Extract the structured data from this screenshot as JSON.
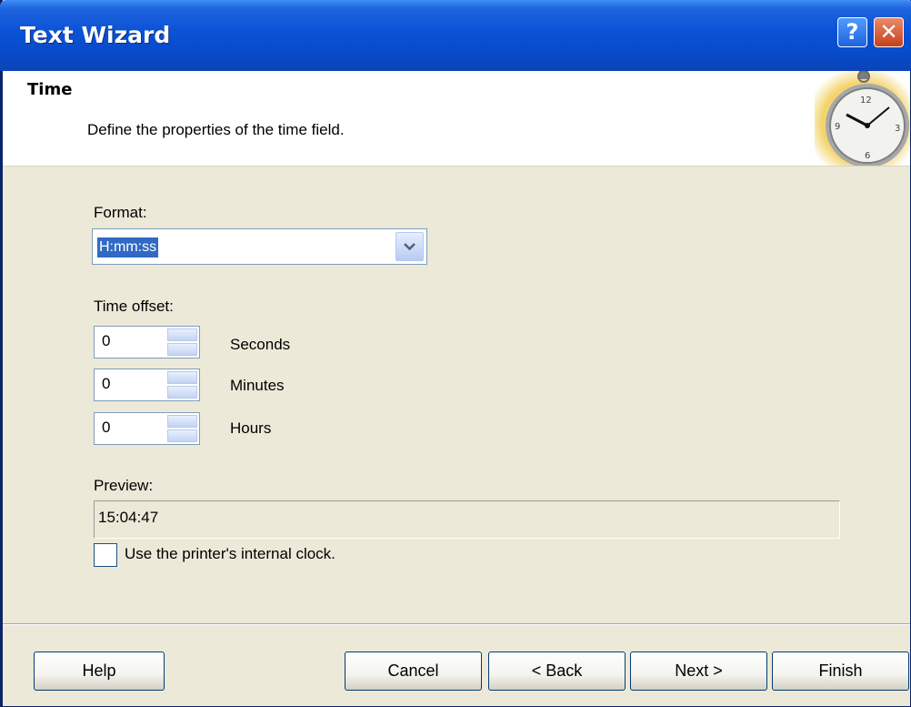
{
  "window": {
    "title": "Text Wizard"
  },
  "title_buttons": {
    "help": "?",
    "close": "✕"
  },
  "header": {
    "title": "Time",
    "subtitle": "Define the properties of the time field.",
    "icon": "stopwatch-icon"
  },
  "format": {
    "label": "Format:",
    "value": "H:mm:ss"
  },
  "time_offset": {
    "label": "Time offset:",
    "rows": [
      {
        "value": "0",
        "unit": "Seconds"
      },
      {
        "value": "0",
        "unit": "Minutes"
      },
      {
        "value": "0",
        "unit": "Hours"
      }
    ]
  },
  "preview": {
    "label": "Preview:",
    "value": "15:04:47"
  },
  "printer_clock": {
    "label": "Use the printer's internal clock.",
    "checked": false
  },
  "buttons": {
    "help": "Help",
    "cancel": "Cancel",
    "back": "< Back",
    "next": "Next >",
    "finish": "Finish"
  },
  "colors": {
    "titlebar": "#0a52d6",
    "selection": "#316ac5",
    "dialog_bg": "#ece9d8",
    "close_button": "#c7401c"
  }
}
